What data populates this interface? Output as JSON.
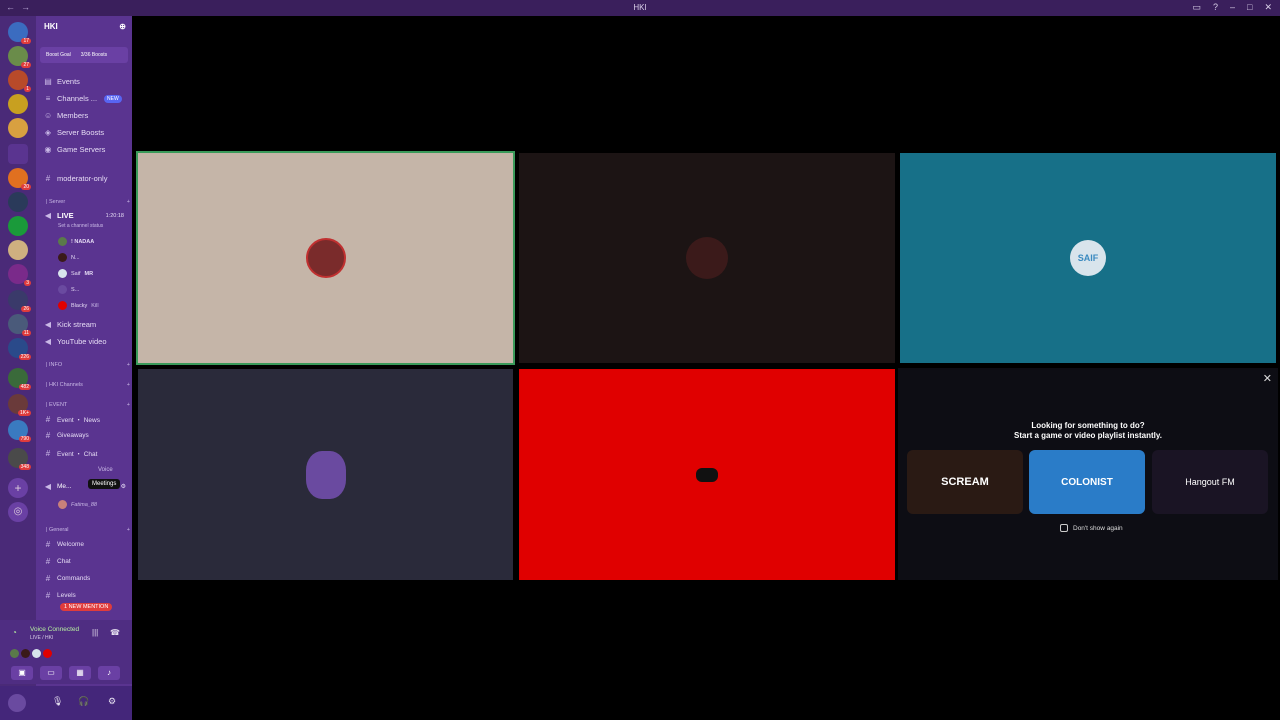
{
  "window": {
    "title": "HKI"
  },
  "server": {
    "name": "HKI",
    "boost_goal": "Boost Goal",
    "boost_count": "3/36 Boosts"
  },
  "guild_badges": [
    "17",
    "27",
    "1",
    "20",
    "3",
    "26",
    "11",
    "226",
    "482",
    "1K+",
    "790",
    "348"
  ],
  "nav": [
    {
      "label": "Events",
      "icon": "calendar-icon"
    },
    {
      "label": "Channels ...",
      "icon": "channels-icon",
      "badge": "NEW"
    },
    {
      "label": "Members",
      "icon": "members-icon"
    },
    {
      "label": "Server Boosts",
      "icon": "boost-icon"
    },
    {
      "label": "Game Servers",
      "icon": "controller-icon"
    }
  ],
  "channels": {
    "moderator": "moderator-only",
    "cat_server": "| Server",
    "live": "LIVE",
    "live_time": "1:20:18",
    "live_status": "Set a channel status",
    "voice_users": [
      "! NADAA",
      "N...",
      "Saif",
      "S...",
      "Blacky"
    ],
    "user_tags": [
      "",
      "",
      "MR",
      "",
      "Kill"
    ],
    "kick": "Kick stream",
    "youtube": "YouTube video",
    "cat_info": "| INFO",
    "cat_hki": "| HKI Channels",
    "cat_event": "| EVENT",
    "event_news": "Event ・ News",
    "giveaways": "Giveaways",
    "event_chat": "Event ・ Chat",
    "event_voice": "Voice",
    "meetings": "Meetings",
    "meetings_user": "Fatima_88",
    "cat_general": "| General",
    "welcome": "Welcome",
    "chat": "Chat",
    "commands": "Commands",
    "levels": "Levels",
    "mention": "1 NEW MENTION"
  },
  "voice_connection": {
    "status": "Voice Connected",
    "location": "LIVE / HKI"
  },
  "tiles": [
    {
      "bg": "#c5b5a8",
      "avatar": "#7a2b2b",
      "speaking": true
    },
    {
      "bg": "#1c1414",
      "avatar": "#3b1a1a",
      "speaking": false
    },
    {
      "bg": "#177088",
      "avatar": "#d8e4ec",
      "label": "SAIF",
      "speaking": false
    },
    {
      "bg": "#2a2a3a",
      "avatar": "#6a4aa0",
      "speaking": false
    },
    {
      "bg": "#e00000",
      "avatar": "#111111",
      "speaking": false
    }
  ],
  "activity": {
    "line1": "Looking for something to do?",
    "line2": "Start a game or video playlist instantly.",
    "cards": [
      {
        "name": "SCREAM",
        "bg": "#2a1a14"
      },
      {
        "name": "COLONIST",
        "bg": "#2a7cc8"
      },
      {
        "name": "Hangout FM",
        "bg": "#1a1424"
      }
    ],
    "dont_show": "Don't show again"
  }
}
